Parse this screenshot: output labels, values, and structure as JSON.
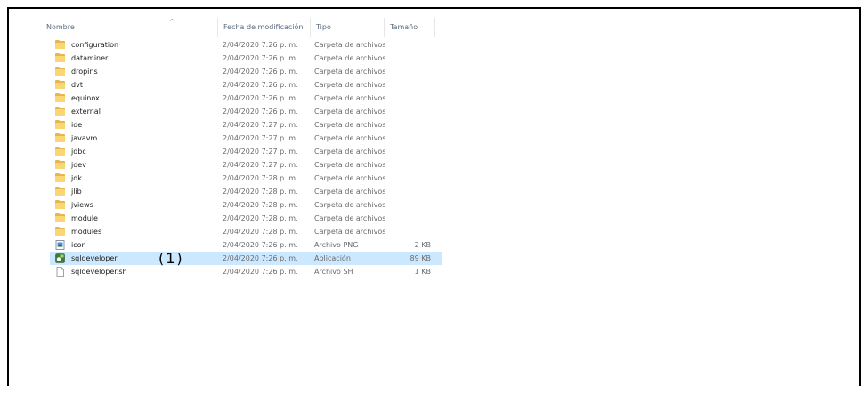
{
  "columns": {
    "name": "Nombre",
    "date": "Fecha de modificación",
    "type": "Tipo",
    "size": "Tamaño",
    "sort_indicator": "^"
  },
  "files": [
    {
      "name": "configuration",
      "date": "2/04/2020 7:26 p. m.",
      "type": "Carpeta de archivos",
      "size": "",
      "icon": "folder-icon"
    },
    {
      "name": "dataminer",
      "date": "2/04/2020 7:26 p. m.",
      "type": "Carpeta de archivos",
      "size": "",
      "icon": "folder-icon"
    },
    {
      "name": "dropins",
      "date": "2/04/2020 7:26 p. m.",
      "type": "Carpeta de archivos",
      "size": "",
      "icon": "folder-icon"
    },
    {
      "name": "dvt",
      "date": "2/04/2020 7:26 p. m.",
      "type": "Carpeta de archivos",
      "size": "",
      "icon": "folder-icon"
    },
    {
      "name": "equinox",
      "date": "2/04/2020 7:26 p. m.",
      "type": "Carpeta de archivos",
      "size": "",
      "icon": "folder-icon"
    },
    {
      "name": "external",
      "date": "2/04/2020 7:26 p. m.",
      "type": "Carpeta de archivos",
      "size": "",
      "icon": "folder-icon"
    },
    {
      "name": "ide",
      "date": "2/04/2020 7:27 p. m.",
      "type": "Carpeta de archivos",
      "size": "",
      "icon": "folder-icon"
    },
    {
      "name": "javavm",
      "date": "2/04/2020 7:27 p. m.",
      "type": "Carpeta de archivos",
      "size": "",
      "icon": "folder-icon"
    },
    {
      "name": "jdbc",
      "date": "2/04/2020 7:27 p. m.",
      "type": "Carpeta de archivos",
      "size": "",
      "icon": "folder-icon"
    },
    {
      "name": "jdev",
      "date": "2/04/2020 7:27 p. m.",
      "type": "Carpeta de archivos",
      "size": "",
      "icon": "folder-icon"
    },
    {
      "name": "jdk",
      "date": "2/04/2020 7:28 p. m.",
      "type": "Carpeta de archivos",
      "size": "",
      "icon": "folder-icon"
    },
    {
      "name": "jlib",
      "date": "2/04/2020 7:28 p. m.",
      "type": "Carpeta de archivos",
      "size": "",
      "icon": "folder-icon"
    },
    {
      "name": "jviews",
      "date": "2/04/2020 7:28 p. m.",
      "type": "Carpeta de archivos",
      "size": "",
      "icon": "folder-icon"
    },
    {
      "name": "module",
      "date": "2/04/2020 7:28 p. m.",
      "type": "Carpeta de archivos",
      "size": "",
      "icon": "folder-icon"
    },
    {
      "name": "modules",
      "date": "2/04/2020 7:28 p. m.",
      "type": "Carpeta de archivos",
      "size": "",
      "icon": "folder-icon"
    },
    {
      "name": "icon",
      "date": "2/04/2020 7:26 p. m.",
      "type": "Archivo PNG",
      "size": "2 KB",
      "icon": "png-image-icon"
    },
    {
      "name": "sqldeveloper",
      "date": "2/04/2020 7:26 p. m.",
      "type": "Aplicación",
      "size": "89 KB",
      "icon": "application-icon",
      "selected": true
    },
    {
      "name": "sqldeveloper.sh",
      "date": "2/04/2020 7:26 p. m.",
      "type": "Archivo SH",
      "size": "1 KB",
      "icon": "document-icon"
    }
  ],
  "annotation": "(1)",
  "colors": {
    "selection": "#cce8ff",
    "folder": "#f9d774",
    "folder_back": "#e8b64a",
    "header_text": "#5c6b80"
  }
}
